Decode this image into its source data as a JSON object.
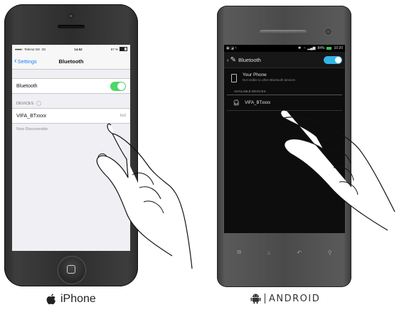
{
  "iphone": {
    "status": {
      "carrier": "Telenor DK",
      "network": "3G",
      "time": "14.52",
      "battery": "67 %"
    },
    "nav": {
      "back_label": "Settings",
      "title": "Bluetooth"
    },
    "bluetooth_row": {
      "label": "Bluetooth",
      "toggle_on": true
    },
    "devices_header": "DEVICES",
    "device": {
      "name": "VIFA_BTxxxx",
      "status": "ted"
    },
    "footer": "Now Discoverable",
    "caption": "iPhone"
  },
  "android": {
    "status": {
      "time": "10:20",
      "battery": "84%"
    },
    "actionbar": {
      "title": "Bluetooth",
      "switch_on": true
    },
    "your_phone": {
      "name": "Your Phone",
      "subtitle": "Not visible to other Bluetooth devices"
    },
    "available_header": "AVAILABLE DEVICES",
    "device": {
      "name": "VIFA_BTxxxx"
    },
    "caption": "ANDROID"
  },
  "colors": {
    "ios_blue": "#1a7ef5",
    "ios_toggle_green": "#4cd964",
    "android_accent": "#33b5e5"
  }
}
